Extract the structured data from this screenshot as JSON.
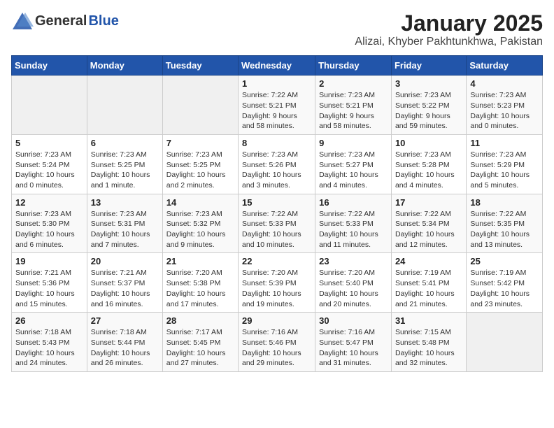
{
  "header": {
    "logo_general": "General",
    "logo_blue": "Blue",
    "title": "January 2025",
    "subtitle": "Alizai, Khyber Pakhtunkhwa, Pakistan"
  },
  "days_of_week": [
    "Sunday",
    "Monday",
    "Tuesday",
    "Wednesday",
    "Thursday",
    "Friday",
    "Saturday"
  ],
  "weeks": [
    [
      {
        "day": "",
        "info": ""
      },
      {
        "day": "",
        "info": ""
      },
      {
        "day": "",
        "info": ""
      },
      {
        "day": "1",
        "info": "Sunrise: 7:22 AM\nSunset: 5:21 PM\nDaylight: 9 hours\nand 58 minutes."
      },
      {
        "day": "2",
        "info": "Sunrise: 7:23 AM\nSunset: 5:21 PM\nDaylight: 9 hours\nand 58 minutes."
      },
      {
        "day": "3",
        "info": "Sunrise: 7:23 AM\nSunset: 5:22 PM\nDaylight: 9 hours\nand 59 minutes."
      },
      {
        "day": "4",
        "info": "Sunrise: 7:23 AM\nSunset: 5:23 PM\nDaylight: 10 hours\nand 0 minutes."
      }
    ],
    [
      {
        "day": "5",
        "info": "Sunrise: 7:23 AM\nSunset: 5:24 PM\nDaylight: 10 hours\nand 0 minutes."
      },
      {
        "day": "6",
        "info": "Sunrise: 7:23 AM\nSunset: 5:25 PM\nDaylight: 10 hours\nand 1 minute."
      },
      {
        "day": "7",
        "info": "Sunrise: 7:23 AM\nSunset: 5:25 PM\nDaylight: 10 hours\nand 2 minutes."
      },
      {
        "day": "8",
        "info": "Sunrise: 7:23 AM\nSunset: 5:26 PM\nDaylight: 10 hours\nand 3 minutes."
      },
      {
        "day": "9",
        "info": "Sunrise: 7:23 AM\nSunset: 5:27 PM\nDaylight: 10 hours\nand 4 minutes."
      },
      {
        "day": "10",
        "info": "Sunrise: 7:23 AM\nSunset: 5:28 PM\nDaylight: 10 hours\nand 4 minutes."
      },
      {
        "day": "11",
        "info": "Sunrise: 7:23 AM\nSunset: 5:29 PM\nDaylight: 10 hours\nand 5 minutes."
      }
    ],
    [
      {
        "day": "12",
        "info": "Sunrise: 7:23 AM\nSunset: 5:30 PM\nDaylight: 10 hours\nand 6 minutes."
      },
      {
        "day": "13",
        "info": "Sunrise: 7:23 AM\nSunset: 5:31 PM\nDaylight: 10 hours\nand 7 minutes."
      },
      {
        "day": "14",
        "info": "Sunrise: 7:23 AM\nSunset: 5:32 PM\nDaylight: 10 hours\nand 9 minutes."
      },
      {
        "day": "15",
        "info": "Sunrise: 7:22 AM\nSunset: 5:33 PM\nDaylight: 10 hours\nand 10 minutes."
      },
      {
        "day": "16",
        "info": "Sunrise: 7:22 AM\nSunset: 5:33 PM\nDaylight: 10 hours\nand 11 minutes."
      },
      {
        "day": "17",
        "info": "Sunrise: 7:22 AM\nSunset: 5:34 PM\nDaylight: 10 hours\nand 12 minutes."
      },
      {
        "day": "18",
        "info": "Sunrise: 7:22 AM\nSunset: 5:35 PM\nDaylight: 10 hours\nand 13 minutes."
      }
    ],
    [
      {
        "day": "19",
        "info": "Sunrise: 7:21 AM\nSunset: 5:36 PM\nDaylight: 10 hours\nand 15 minutes."
      },
      {
        "day": "20",
        "info": "Sunrise: 7:21 AM\nSunset: 5:37 PM\nDaylight: 10 hours\nand 16 minutes."
      },
      {
        "day": "21",
        "info": "Sunrise: 7:20 AM\nSunset: 5:38 PM\nDaylight: 10 hours\nand 17 minutes."
      },
      {
        "day": "22",
        "info": "Sunrise: 7:20 AM\nSunset: 5:39 PM\nDaylight: 10 hours\nand 19 minutes."
      },
      {
        "day": "23",
        "info": "Sunrise: 7:20 AM\nSunset: 5:40 PM\nDaylight: 10 hours\nand 20 minutes."
      },
      {
        "day": "24",
        "info": "Sunrise: 7:19 AM\nSunset: 5:41 PM\nDaylight: 10 hours\nand 21 minutes."
      },
      {
        "day": "25",
        "info": "Sunrise: 7:19 AM\nSunset: 5:42 PM\nDaylight: 10 hours\nand 23 minutes."
      }
    ],
    [
      {
        "day": "26",
        "info": "Sunrise: 7:18 AM\nSunset: 5:43 PM\nDaylight: 10 hours\nand 24 minutes."
      },
      {
        "day": "27",
        "info": "Sunrise: 7:18 AM\nSunset: 5:44 PM\nDaylight: 10 hours\nand 26 minutes."
      },
      {
        "day": "28",
        "info": "Sunrise: 7:17 AM\nSunset: 5:45 PM\nDaylight: 10 hours\nand 27 minutes."
      },
      {
        "day": "29",
        "info": "Sunrise: 7:16 AM\nSunset: 5:46 PM\nDaylight: 10 hours\nand 29 minutes."
      },
      {
        "day": "30",
        "info": "Sunrise: 7:16 AM\nSunset: 5:47 PM\nDaylight: 10 hours\nand 31 minutes."
      },
      {
        "day": "31",
        "info": "Sunrise: 7:15 AM\nSunset: 5:48 PM\nDaylight: 10 hours\nand 32 minutes."
      },
      {
        "day": "",
        "info": ""
      }
    ]
  ]
}
